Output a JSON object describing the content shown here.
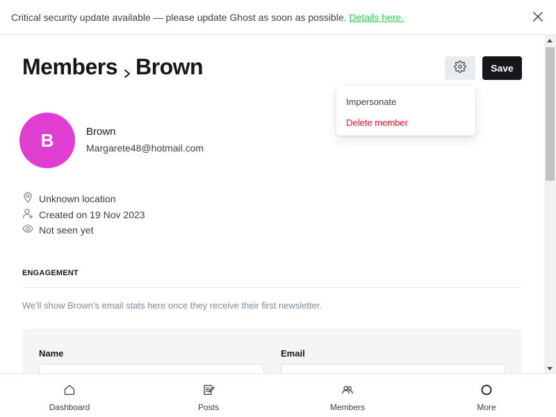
{
  "banner": {
    "message": "Critical security update available — please update Ghost as soon as possible.",
    "link_text": "Details here.",
    "close_icon": "close-icon"
  },
  "header": {
    "breadcrumb_parent": "Members",
    "breadcrumb_current": "Brown",
    "settings_icon": "gear-icon",
    "save_label": "Save"
  },
  "dropdown": {
    "items": [
      {
        "label": "Impersonate"
      },
      {
        "label": "Delete member"
      }
    ]
  },
  "member": {
    "initial": "B",
    "name": "Brown",
    "email": "Margarete48@hotmail.com",
    "avatar_color": "#df3ed0",
    "location": "Unknown location",
    "created": "Created on 19 Nov 2023",
    "last_seen": "Not seen yet"
  },
  "engagement": {
    "heading": "ENGAGEMENT",
    "note": "We'll show Brown's email stats here once they receive their first newsletter."
  },
  "form": {
    "name_label": "Name",
    "email_label": "Email"
  },
  "nav": {
    "items": [
      {
        "label": "Dashboard",
        "icon": "home-icon"
      },
      {
        "label": "Posts",
        "icon": "posts-icon"
      },
      {
        "label": "Members",
        "icon": "members-icon"
      },
      {
        "label": "More",
        "icon": "more-icon"
      }
    ]
  },
  "colors": {
    "accent_green": "#30cf43",
    "danger": "#f50b23",
    "primary_dark": "#15171a"
  }
}
